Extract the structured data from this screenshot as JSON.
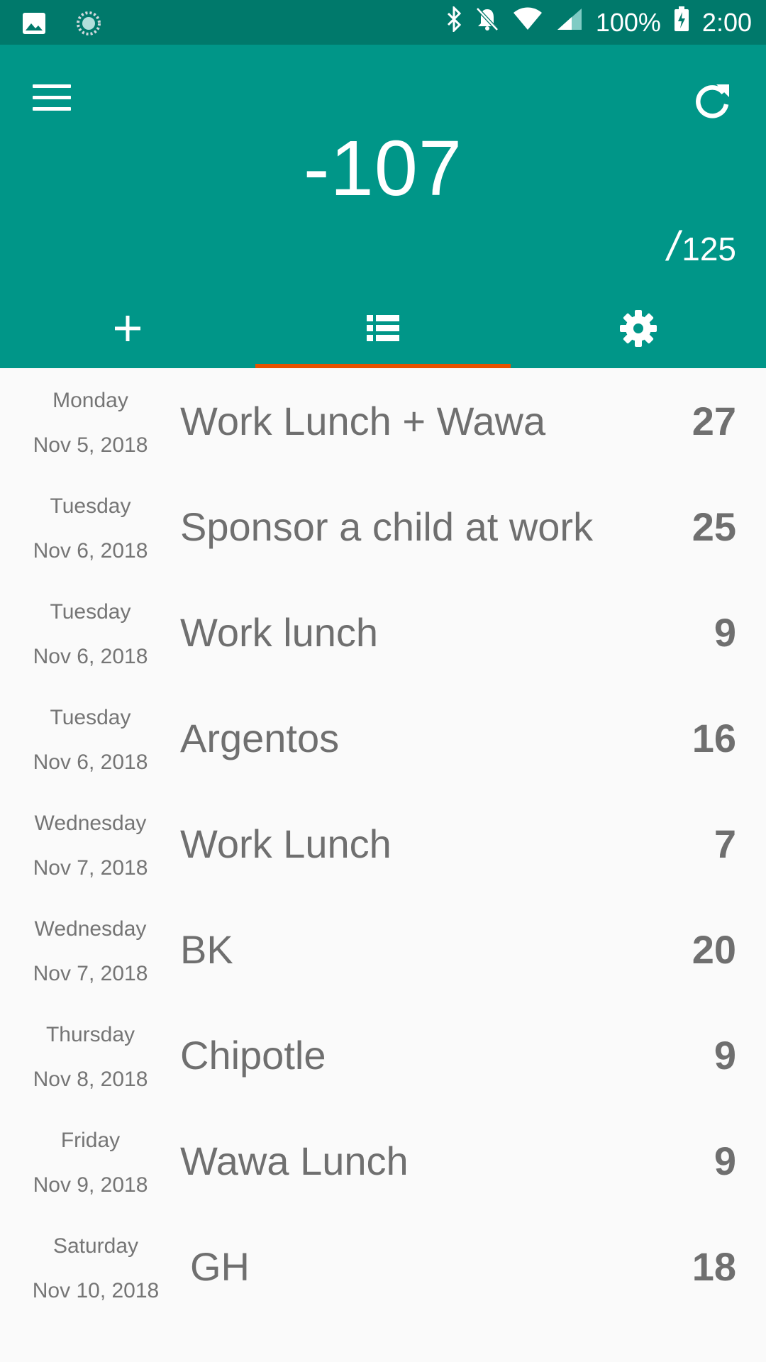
{
  "status_bar": {
    "battery": "100%",
    "time": "2:00",
    "icons": [
      "image-icon",
      "sync-icon",
      "bluetooth-icon",
      "notifications-off-icon",
      "wifi-icon",
      "signal-icon",
      "battery-charging-icon"
    ]
  },
  "header": {
    "balance": "-107",
    "budget_slash": "/",
    "budget": "125",
    "menu_icon": "menu-icon",
    "refresh_icon": "refresh-icon"
  },
  "tabs": [
    {
      "icon": "add-icon",
      "active": false
    },
    {
      "icon": "list-icon",
      "active": true
    },
    {
      "icon": "gear-icon",
      "active": false
    }
  ],
  "entries": [
    {
      "day": "Monday",
      "date": "Nov 5, 2018",
      "description": "Work Lunch + Wawa",
      "amount": "27"
    },
    {
      "day": "Tuesday",
      "date": "Nov 6, 2018",
      "description": "Sponsor a child at work",
      "amount": "25"
    },
    {
      "day": "Tuesday",
      "date": "Nov 6, 2018",
      "description": "Work lunch",
      "amount": "9"
    },
    {
      "day": "Tuesday",
      "date": "Nov 6, 2018",
      "description": "Argentos",
      "amount": "16"
    },
    {
      "day": "Wednesday",
      "date": "Nov 7, 2018",
      "description": "Work Lunch",
      "amount": "7"
    },
    {
      "day": "Wednesday",
      "date": "Nov 7, 2018",
      "description": "BK",
      "amount": "20"
    },
    {
      "day": "Thursday",
      "date": "Nov 8, 2018",
      "description": "Chipotle",
      "amount": "9"
    },
    {
      "day": "Friday",
      "date": "Nov 9, 2018",
      "description": "Wawa Lunch",
      "amount": "9"
    },
    {
      "day": "Saturday",
      "date": "Nov 10, 2018",
      "description": " GH",
      "amount": "18"
    }
  ],
  "colors": {
    "primary": "#009688",
    "primary_dark": "#00796b",
    "tab_indicator": "#e65100",
    "text_gray": "#6f6f6f"
  }
}
